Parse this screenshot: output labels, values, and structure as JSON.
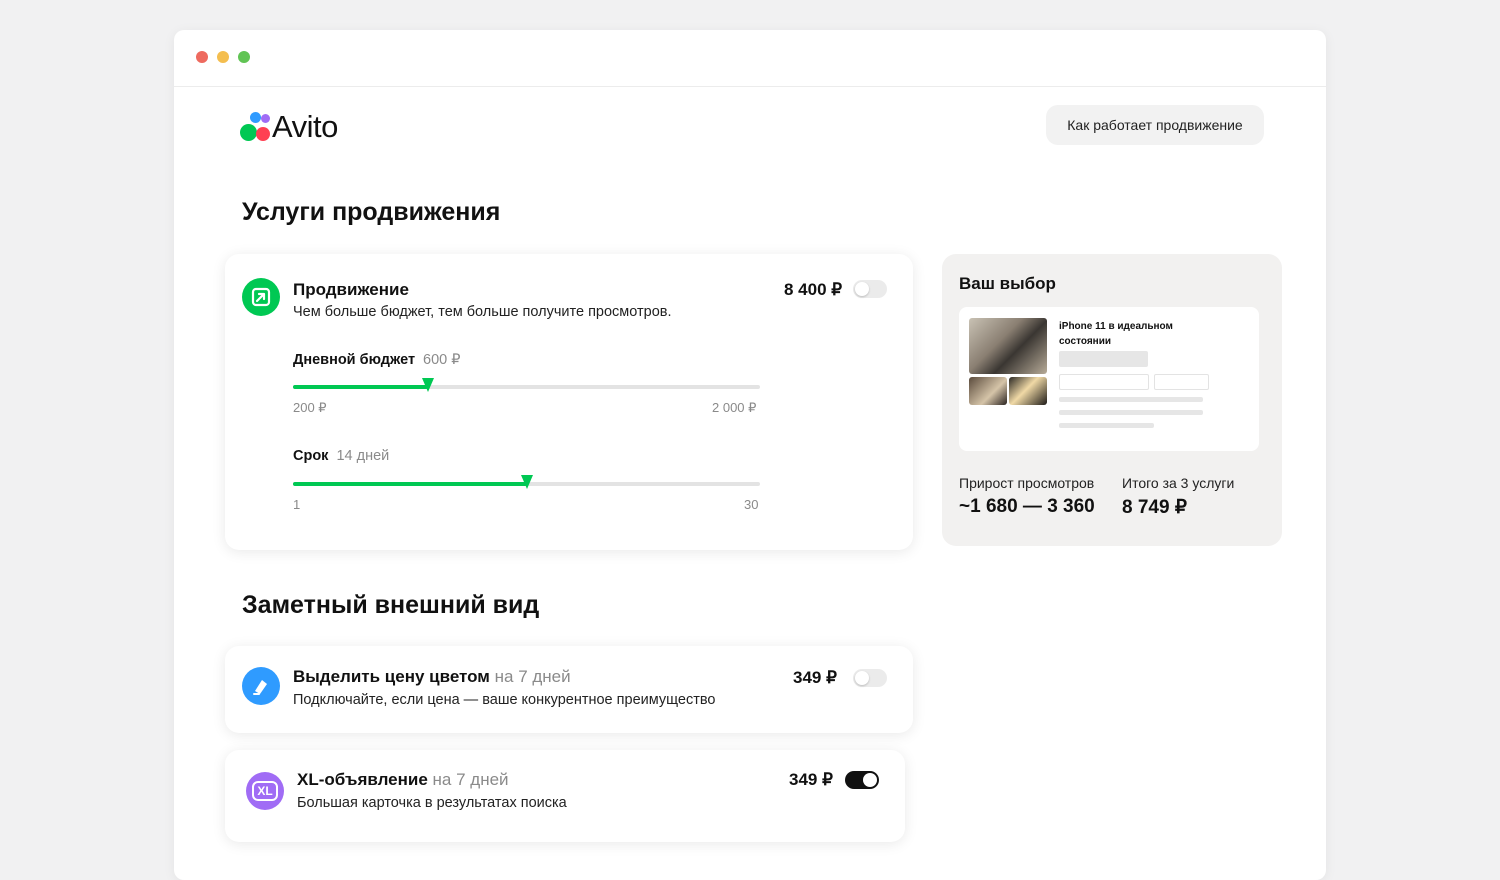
{
  "brand": {
    "name": "Avito"
  },
  "header": {
    "how_button": "Как работает продвижение"
  },
  "sections": {
    "promotion_title": "Услуги продвижения",
    "appearance_title": "Заметный внешний вид"
  },
  "promotion": {
    "title": "Продвижение",
    "description": "Чем больше бюджет, тем больше получите просмотров.",
    "price": "8 400 ₽",
    "enabled": false,
    "budget": {
      "label": "Дневной бюджет",
      "value": "600 ₽",
      "min": "200 ₽",
      "max": "2 000 ₽",
      "fraction": 0.29
    },
    "duration": {
      "label": "Срок",
      "value": "14 дней",
      "min": "1",
      "max": "30",
      "fraction": 0.5
    }
  },
  "color_price": {
    "title": "Выделить цену цветом",
    "period": "на 7 дней",
    "description": "Подключайте, если цена — ваше конкурентное преимущество",
    "price": "349 ₽",
    "enabled": false
  },
  "xl_listing": {
    "title": "XL-объявление",
    "period": "на 7 дней",
    "description": "Большая карточка в результатах поиска",
    "price": "349 ₽",
    "enabled": true,
    "icon_text": "XL"
  },
  "summary": {
    "title": "Ваш выбор",
    "listing_title": "iPhone 11 в идеальном состоянии",
    "views_label": "Прирост просмотров",
    "views_value": "~1 680 — 3 360",
    "total_label": "Итого за 3 услуги",
    "total_value": "8 749 ₽"
  },
  "colors": {
    "accent": "#00c853",
    "blue": "#2f9bff",
    "purple": "#a06cf5",
    "red": "#ff4053"
  }
}
